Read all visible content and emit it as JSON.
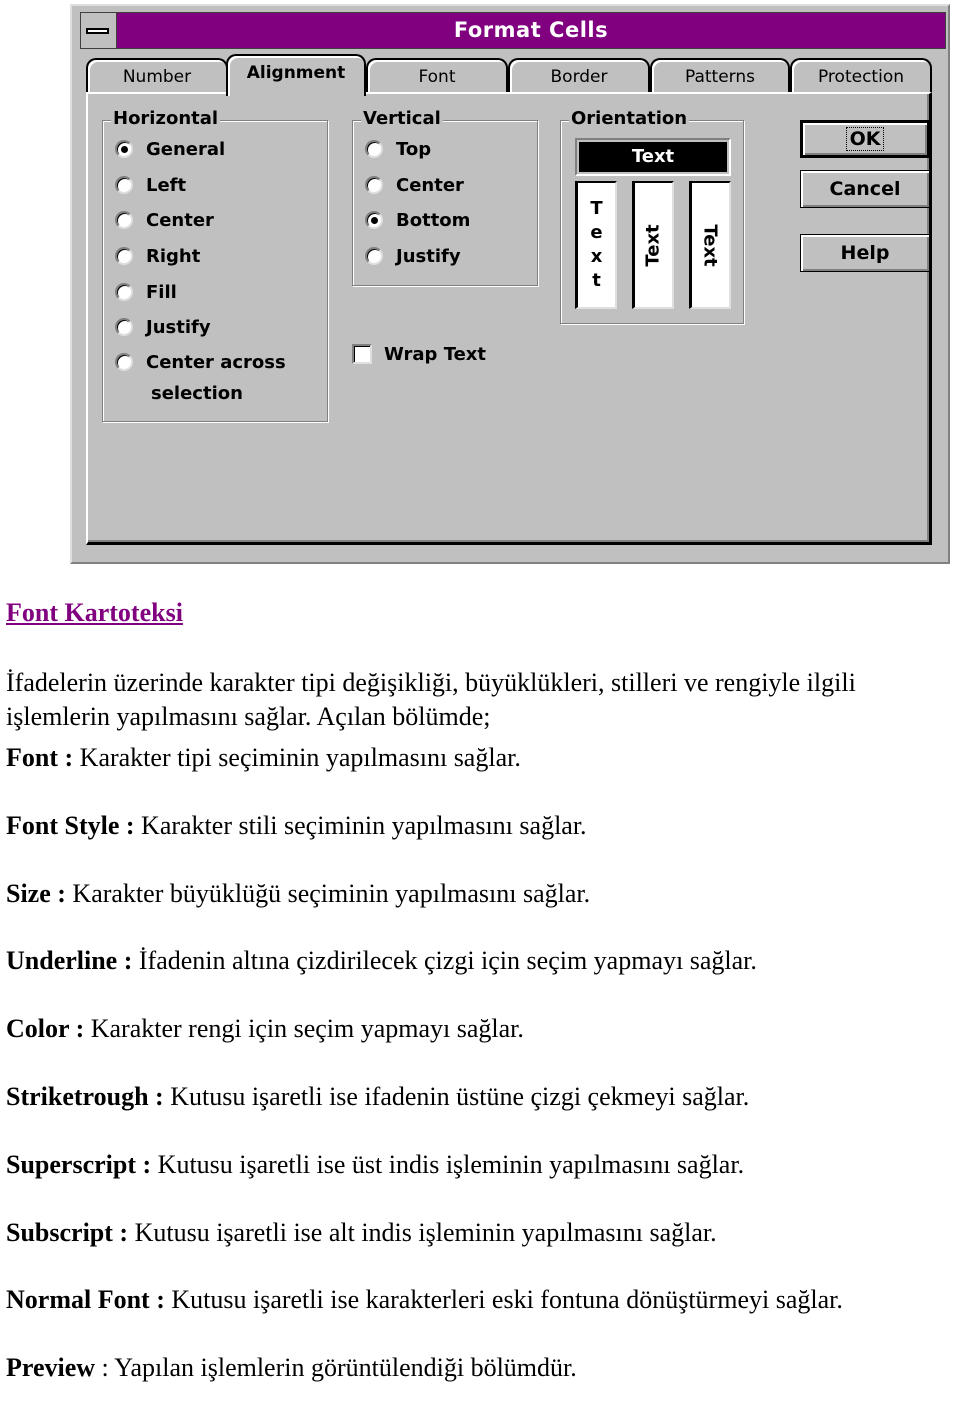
{
  "dialog": {
    "title": "Format Cells",
    "title_bar_color": "#800080",
    "system_menu_icon": "system-menu-icon",
    "tabs": [
      {
        "label": "Number",
        "active": false
      },
      {
        "label": "Alignment",
        "active": true
      },
      {
        "label": "Font",
        "active": false
      },
      {
        "label": "Border",
        "active": false
      },
      {
        "label": "Patterns",
        "active": false
      },
      {
        "label": "Protection",
        "active": false
      }
    ],
    "horizontal": {
      "label": "Horizontal",
      "options": [
        {
          "label": "General",
          "checked": true
        },
        {
          "label": "Left",
          "checked": false
        },
        {
          "label": "Center",
          "checked": false
        },
        {
          "label": "Right",
          "checked": false
        },
        {
          "label": "Fill",
          "checked": false
        },
        {
          "label": "Justify",
          "checked": false
        },
        {
          "label": "Center across",
          "label_line2": "selection",
          "checked": false
        }
      ]
    },
    "vertical": {
      "label": "Vertical",
      "options": [
        {
          "label": "Top",
          "checked": false
        },
        {
          "label": "Center",
          "checked": false
        },
        {
          "label": "Bottom",
          "checked": true
        },
        {
          "label": "Justify",
          "checked": false
        }
      ]
    },
    "wrap_text": {
      "label": "Wrap Text",
      "checked": false
    },
    "orientation": {
      "label": "Orientation",
      "horizontal_sample": "Text",
      "stacked_sample": [
        "T",
        "e",
        "x",
        "t"
      ],
      "rotated_up_sample": "Text",
      "rotated_down_sample": "Text",
      "selected": "horizontal"
    },
    "buttons": {
      "ok": "OK",
      "cancel": "Cancel",
      "help": "Help"
    }
  },
  "document": {
    "heading": "Font Kartoteksi",
    "heading_color": "#800080",
    "intro_line1": "İfadelerin üzerinde karakter tipi değişikliği, büyüklükleri, stilleri ve rengiyle ilgili",
    "intro_line2": "işlemlerin yapılmasını sağlar. Açılan bölümde;",
    "definitions": [
      {
        "term": "Font :",
        "text": " Karakter tipi seçiminin yapılmasını sağlar."
      },
      {
        "term": "Font Style :",
        "text": " Karakter stili seçiminin yapılmasını sağlar."
      },
      {
        "term": "Size :",
        "text": " Karakter büyüklüğü seçiminin yapılmasını sağlar."
      },
      {
        "term": "Underline :",
        "text": " İfadenin altına çizdirilecek çizgi için seçim yapmayı sağlar."
      },
      {
        "term": "Color :",
        "text": " Karakter rengi için seçim yapmayı sağlar."
      },
      {
        "term": "Striketrough :",
        "text": " Kutusu işaretli ise ifadenin üstüne çizgi çekmeyi sağlar."
      },
      {
        "term": "Superscript :",
        "text": " Kutusu işaretli ise üst indis işleminin yapılmasını sağlar."
      },
      {
        "term": "Subscript :",
        "text": " Kutusu işaretli ise alt indis işleminin yapılmasını sağlar."
      },
      {
        "term": "Normal Font :",
        "text": " Kutusu işaretli ise karakterleri eski fontuna dönüştürmeyi sağlar."
      },
      {
        "term": "Preview",
        "text": " : Yapılan işlemlerin görüntülendiği bölümdür."
      }
    ]
  }
}
